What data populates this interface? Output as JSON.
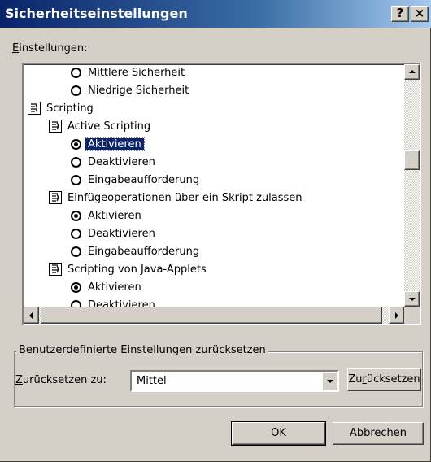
{
  "window": {
    "title": "Sicherheitseinstellungen",
    "help_label": "?",
    "close_label": "×"
  },
  "settings_label": {
    "mnemonic": "E",
    "rest": "instellungen:"
  },
  "tree": [
    {
      "kind": "radio",
      "indent": 2,
      "checked": false,
      "label": "Mittlere Sicherheit"
    },
    {
      "kind": "radio",
      "indent": 2,
      "checked": false,
      "label": "Niedrige Sicherheit"
    },
    {
      "kind": "category",
      "indent": 0,
      "label": "Scripting"
    },
    {
      "kind": "category",
      "indent": 1,
      "label": "Active Scripting"
    },
    {
      "kind": "radio",
      "indent": 2,
      "checked": true,
      "selected": true,
      "label": "Aktivieren"
    },
    {
      "kind": "radio",
      "indent": 2,
      "checked": false,
      "label": "Deaktivieren"
    },
    {
      "kind": "radio",
      "indent": 2,
      "checked": false,
      "label": "Eingabeaufforderung"
    },
    {
      "kind": "category",
      "indent": 1,
      "label": "Einfügeoperationen über ein Skript zulassen"
    },
    {
      "kind": "radio",
      "indent": 2,
      "checked": true,
      "label": "Aktivieren"
    },
    {
      "kind": "radio",
      "indent": 2,
      "checked": false,
      "label": "Deaktivieren"
    },
    {
      "kind": "radio",
      "indent": 2,
      "checked": false,
      "label": "Eingabeaufforderung"
    },
    {
      "kind": "category",
      "indent": 1,
      "label": "Scripting von Java-Applets"
    },
    {
      "kind": "radio",
      "indent": 2,
      "checked": true,
      "label": "Aktivieren"
    },
    {
      "kind": "radio",
      "indent": 2,
      "checked": false,
      "label": "Deaktivieren"
    }
  ],
  "reset_group": {
    "title": "Benutzerdefinierte Einstellungen zurücksetzen",
    "label_mnemonic": "Z",
    "label_rest": "urücksetzen zu:",
    "selected_value": "Mittel",
    "button_pre": "Zu",
    "button_mnemonic": "r",
    "button_post": "ücksetzen"
  },
  "buttons": {
    "ok": "OK",
    "cancel": "Abbrechen"
  },
  "colors": {
    "titlebar": "#0a246a",
    "selection": "#0a246a",
    "face": "#d4d0c8"
  }
}
